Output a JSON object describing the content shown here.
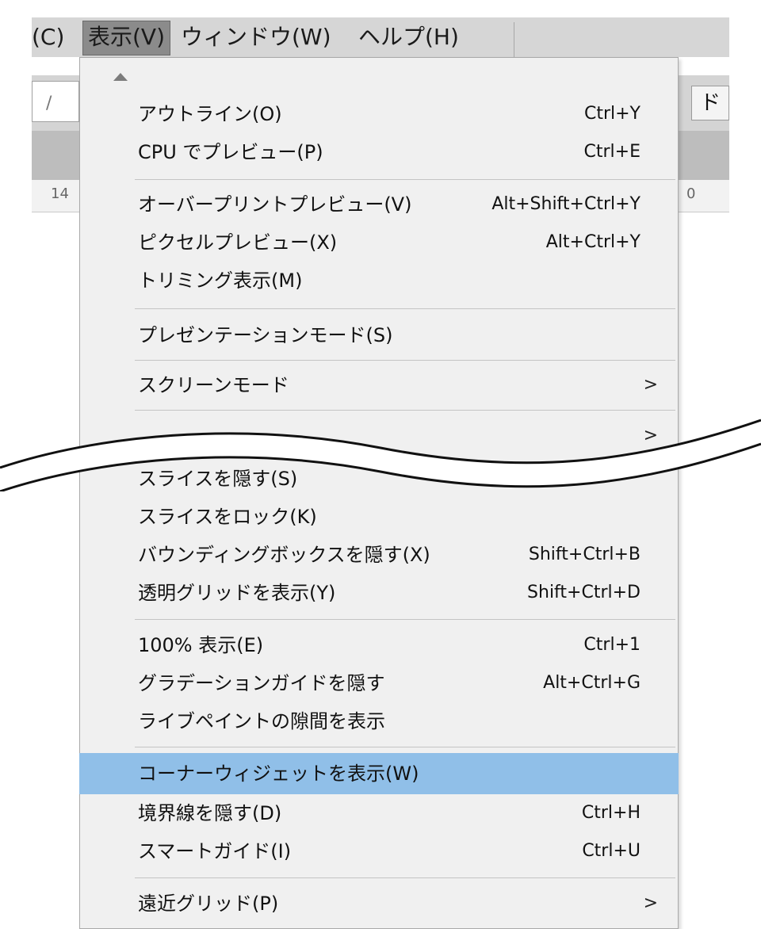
{
  "menubar": {
    "items": [
      {
        "label": "(C)"
      },
      {
        "label": "表示(V)"
      },
      {
        "label": "ウィンドウ(W)"
      },
      {
        "label": "ヘルプ(H)"
      }
    ]
  },
  "background": {
    "tool_right_label": "ド",
    "ruler_left_number": "14",
    "ruler_right_number": "0",
    "field_slash": "/"
  },
  "menu": {
    "items": [
      {
        "label": "アウトライン(O)",
        "shortcut": "Ctrl+Y"
      },
      {
        "label": "CPU でプレビュー(P)",
        "shortcut": "Ctrl+E"
      },
      {
        "label": "オーバープリントプレビュー(V)",
        "shortcut": "Alt+Shift+Ctrl+Y"
      },
      {
        "label": "ピクセルプレビュー(X)",
        "shortcut": "Alt+Ctrl+Y"
      },
      {
        "label": "トリミング表示(M)",
        "shortcut": ""
      },
      {
        "label": "プレゼンテーションモード(S)",
        "shortcut": ""
      },
      {
        "label": "スクリーンモード",
        "submenu_arrow": ">"
      },
      {
        "label": "",
        "submenu_arrow": ">"
      },
      {
        "label": "スライスを隠す(S)",
        "shortcut": ""
      },
      {
        "label": "スライスをロック(K)",
        "shortcut": ""
      },
      {
        "label": "バウンディングボックスを隠す(X)",
        "shortcut": "Shift+Ctrl+B"
      },
      {
        "label": "透明グリッドを表示(Y)",
        "shortcut": "Shift+Ctrl+D"
      },
      {
        "label": "100% 表示(E)",
        "shortcut": "Ctrl+1"
      },
      {
        "label": "グラデーションガイドを隠す",
        "shortcut": "Alt+Ctrl+G"
      },
      {
        "label": "ライブペイントの隙間を表示",
        "shortcut": ""
      },
      {
        "label": "コーナーウィジェットを表示(W)",
        "shortcut": ""
      },
      {
        "label": "境界線を隠す(D)",
        "shortcut": "Ctrl+H"
      },
      {
        "label": "スマートガイド(I)",
        "shortcut": "Ctrl+U"
      },
      {
        "label": "遠近グリッド(P)",
        "submenu_arrow": ">"
      }
    ]
  },
  "colors": {
    "highlight": "#90bfe8",
    "menu_bg": "#f0f0f0",
    "menubar_bg": "#d6d6d6",
    "active_menubar_item": "#8b8b8b"
  }
}
